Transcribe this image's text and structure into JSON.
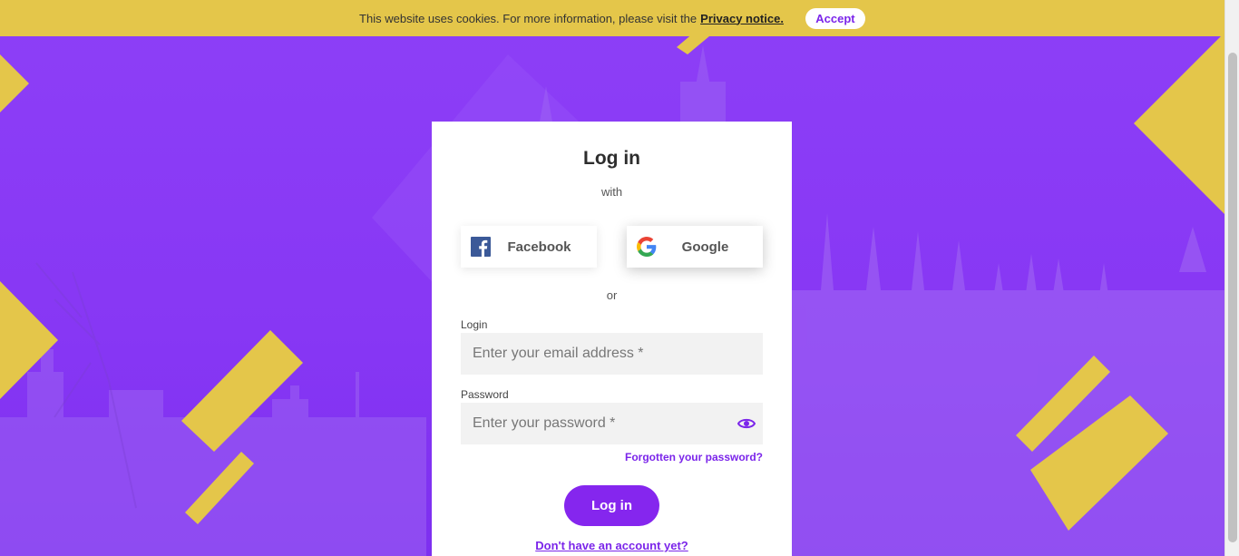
{
  "cookie": {
    "message": "This website uses cookies. For more information, please visit the",
    "link_label": "Privacy notice.",
    "accept_label": "Accept"
  },
  "login": {
    "title": "Log in",
    "with_label": "with",
    "facebook_label": "Facebook",
    "google_label": "Google",
    "or_label": "or",
    "login_label": "Login",
    "email_placeholder": "Enter your email address *",
    "password_label": "Password",
    "password_placeholder": "Enter your password *",
    "forgot_label": "Forgotten your password?",
    "submit_label": "Log in",
    "signup_label": "Don't have an account yet?"
  },
  "colors": {
    "brand_purple": "#8526ee",
    "accent_yellow": "#e4c64a",
    "background_purple": "#8a3cf5"
  },
  "icons": [
    "facebook-icon",
    "google-icon",
    "eye-icon"
  ]
}
